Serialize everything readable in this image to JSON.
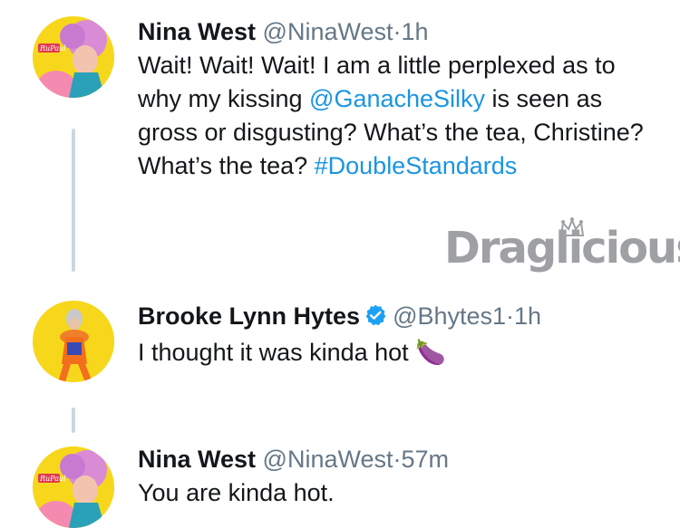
{
  "tweets": [
    {
      "name": "Nina West",
      "handle": "@NinaWest",
      "separator": "·",
      "time": "1h",
      "verified": false,
      "avatar_icon": "drag-queen-pink-wig",
      "text_parts": [
        "Wait! Wait! Wait! I am a little perplexed as to why my kissing ",
        "@GanacheSilky",
        " is seen as gross or disgusting? What’s the tea, Christine? What’s the tea? ",
        "#DoubleStandards"
      ]
    },
    {
      "name": "Brooke Lynn Hytes",
      "handle": "@Bhytes1",
      "separator": "·",
      "time": "1h",
      "verified": true,
      "avatar_icon": "drag-queen-orange-outfit",
      "text": "I thought it was kinda hot",
      "emoji": "🍆"
    },
    {
      "name": "Nina West",
      "handle": "@NinaWest",
      "separator": "·",
      "time": "57m",
      "verified": false,
      "avatar_icon": "drag-queen-pink-wig",
      "text": "You are kinda hot."
    }
  ],
  "avatar_badge": "RuPaul",
  "watermark": "Draglicious",
  "colors": {
    "link": "#1b95e0",
    "muted": "#657786",
    "thread_line": "#ccd6dd",
    "avatar_bg": "#f7d71c",
    "verified": "#1da1f2"
  }
}
